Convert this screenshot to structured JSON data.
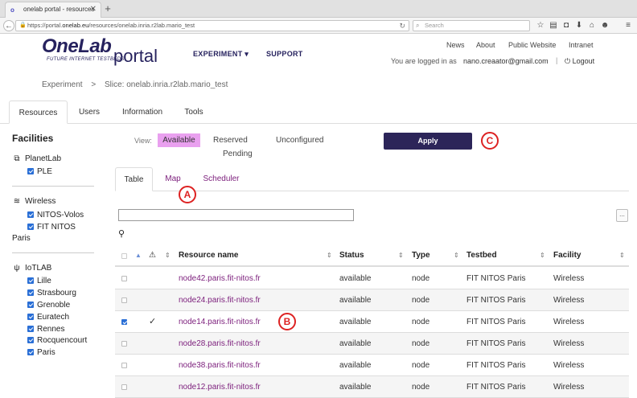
{
  "browser": {
    "tab_title": "onelab portal - resources",
    "tab_close": "✕",
    "new_tab": "+",
    "url_prefix": "https://portal.",
    "url_domain": "onelab.eu",
    "url_suffix": "/resources/onelab.inria.r2lab.mario_test",
    "search_placeholder": "Search"
  },
  "header": {
    "logo_main": "OneLab",
    "logo_tagline": "FUTURE INTERNET TESTBEDS",
    "logo_portal": "portal",
    "nav": [
      {
        "label": "EXPERIMENT ▾"
      },
      {
        "label": "SUPPORT"
      }
    ],
    "top_links": [
      "News",
      "About",
      "Public Website",
      "Intranet"
    ],
    "logged_in_text": "You are logged in as",
    "user_email": "nano.creaator@gmail.com",
    "separator": "|",
    "logout_label": "Logout"
  },
  "breadcrumb": {
    "root": "Experiment",
    "sep": ">",
    "current": "Slice: onelab.inria.r2lab.mario_test"
  },
  "main_tabs": [
    {
      "label": "Resources",
      "active": true
    },
    {
      "label": "Users",
      "active": false
    },
    {
      "label": "Information",
      "active": false
    },
    {
      "label": "Tools",
      "active": false
    }
  ],
  "sidebar": {
    "title": "Facilities",
    "groups": [
      {
        "name": "PlanetLab",
        "icon": "network-icon",
        "items": [
          "PLE"
        ]
      },
      {
        "name": "Wireless",
        "icon": "wifi-icon",
        "items": [
          "NITOS-Volos",
          "FIT NITOS",
          "Paris"
        ]
      },
      {
        "name": "IoTLAB",
        "icon": "antenna-icon",
        "items": [
          "Lille",
          "Strasbourg",
          "Grenoble",
          "Euratech",
          "Rennes",
          "Rocquencourt",
          "Paris"
        ]
      }
    ]
  },
  "view": {
    "label": "View:",
    "available": "Available",
    "reserved": "Reserved",
    "pending": "Pending",
    "unconfigured": "Unconfigured",
    "apply": "Apply",
    "highlight_color": "#e9a0ef"
  },
  "markers": {
    "a": "A",
    "b": "B",
    "c": "C"
  },
  "sub_tabs": [
    {
      "label": "Table",
      "active": true
    },
    {
      "label": "Map",
      "active": false
    },
    {
      "label": "Scheduler",
      "active": false
    }
  ],
  "filter": {
    "value": "",
    "more": "..."
  },
  "table": {
    "columns": {
      "warning": "⚠",
      "resource_name": "Resource name",
      "status": "Status",
      "type": "Type",
      "testbed": "Testbed",
      "facility": "Facility"
    },
    "rows": [
      {
        "checked": false,
        "mark": "",
        "name": "node42.paris.fit-nitos.fr",
        "status": "available",
        "type": "node",
        "testbed": "FIT NITOS Paris",
        "facility": "Wireless"
      },
      {
        "checked": false,
        "mark": "",
        "name": "node24.paris.fit-nitos.fr",
        "status": "available",
        "type": "node",
        "testbed": "FIT NITOS Paris",
        "facility": "Wireless"
      },
      {
        "checked": true,
        "mark": "✓",
        "name": "node14.paris.fit-nitos.fr",
        "status": "available",
        "type": "node",
        "testbed": "FIT NITOS Paris",
        "facility": "Wireless"
      },
      {
        "checked": false,
        "mark": "",
        "name": "node28.paris.fit-nitos.fr",
        "status": "available",
        "type": "node",
        "testbed": "FIT NITOS Paris",
        "facility": "Wireless"
      },
      {
        "checked": false,
        "mark": "",
        "name": "node38.paris.fit-nitos.fr",
        "status": "available",
        "type": "node",
        "testbed": "FIT NITOS Paris",
        "facility": "Wireless"
      },
      {
        "checked": false,
        "mark": "",
        "name": "node12.paris.fit-nitos.fr",
        "status": "available",
        "type": "node",
        "testbed": "FIT NITOS Paris",
        "facility": "Wireless"
      }
    ]
  }
}
